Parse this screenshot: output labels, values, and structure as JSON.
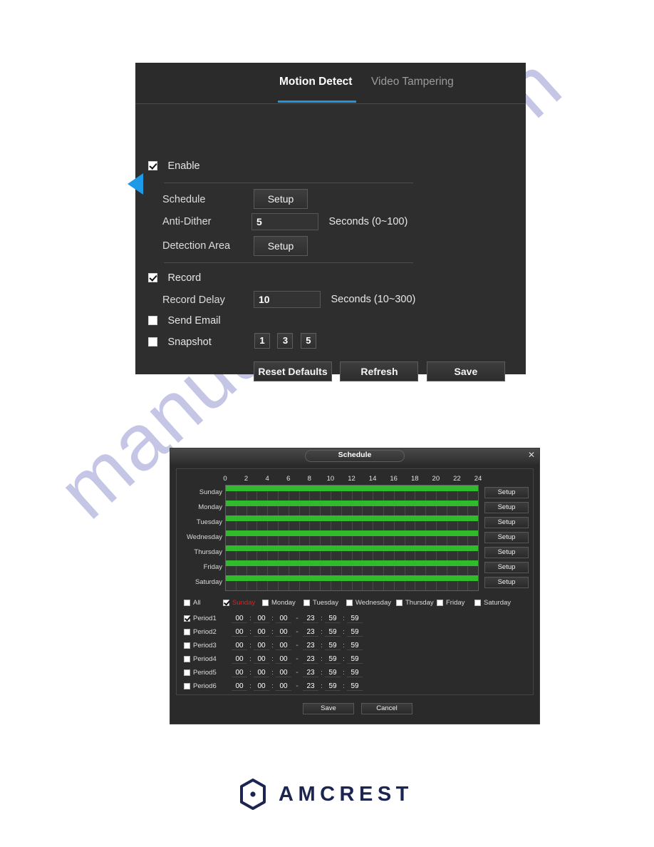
{
  "watermark": {
    "text": "manualshive.com"
  },
  "motion_detect_panel": {
    "tabs": [
      {
        "label": "Motion Detect",
        "active": true
      },
      {
        "label": "Video Tampering",
        "active": false
      }
    ],
    "enable": {
      "label": "Enable",
      "checked": true
    },
    "schedule": {
      "label": "Schedule",
      "button_label": "Setup"
    },
    "anti_dither": {
      "label": "Anti-Dither",
      "value": "5",
      "units": "Seconds (0~100)"
    },
    "detection_area": {
      "label": "Detection Area",
      "button_label": "Setup"
    },
    "record": {
      "label": "Record",
      "checked": true
    },
    "record_delay": {
      "label": "Record Delay",
      "value": "10",
      "units": "Seconds (10~300)"
    },
    "send_email": {
      "label": "Send Email",
      "checked": false
    },
    "snapshot": {
      "label": "Snapshot",
      "checked": false,
      "options": [
        "1",
        "3",
        "5"
      ]
    },
    "actions": {
      "reset_defaults": "Reset Defaults",
      "refresh": "Refresh",
      "save": "Save"
    },
    "accent_color": "#1e96e0"
  },
  "schedule_dialog": {
    "title": "Schedule",
    "close_label": "✕",
    "axis_ticks": [
      "0",
      "2",
      "4",
      "6",
      "8",
      "10",
      "12",
      "14",
      "16",
      "18",
      "20",
      "22",
      "24"
    ],
    "days": [
      {
        "name": "Sunday",
        "setup_label": "Setup"
      },
      {
        "name": "Monday",
        "setup_label": "Setup"
      },
      {
        "name": "Tuesday",
        "setup_label": "Setup"
      },
      {
        "name": "Wednesday",
        "setup_label": "Setup"
      },
      {
        "name": "Thursday",
        "setup_label": "Setup"
      },
      {
        "name": "Friday",
        "setup_label": "Setup"
      },
      {
        "name": "Saturday",
        "setup_label": "Setup"
      }
    ],
    "day_checkboxes": [
      {
        "label": "All",
        "checked": false,
        "selected": false
      },
      {
        "label": "Sunday",
        "checked": true,
        "selected": true
      },
      {
        "label": "Monday",
        "checked": false,
        "selected": false
      },
      {
        "label": "Tuesday",
        "checked": false,
        "selected": false
      },
      {
        "label": "Wednesday",
        "checked": false,
        "selected": false
      },
      {
        "label": "Thursday",
        "checked": false,
        "selected": false
      },
      {
        "label": "Friday",
        "checked": false,
        "selected": false
      },
      {
        "label": "Saturday",
        "checked": false,
        "selected": false
      }
    ],
    "periods": [
      {
        "label": "Period1",
        "checked": true,
        "start_h": "00",
        "start_m": "00",
        "start_s": "00",
        "end_h": "23",
        "end_m": "59",
        "end_s": "59"
      },
      {
        "label": "Period2",
        "checked": false,
        "start_h": "00",
        "start_m": "00",
        "start_s": "00",
        "end_h": "23",
        "end_m": "59",
        "end_s": "59"
      },
      {
        "label": "Period3",
        "checked": false,
        "start_h": "00",
        "start_m": "00",
        "start_s": "00",
        "end_h": "23",
        "end_m": "59",
        "end_s": "59"
      },
      {
        "label": "Period4",
        "checked": false,
        "start_h": "00",
        "start_m": "00",
        "start_s": "00",
        "end_h": "23",
        "end_m": "59",
        "end_s": "59"
      },
      {
        "label": "Period5",
        "checked": false,
        "start_h": "00",
        "start_m": "00",
        "start_s": "00",
        "end_h": "23",
        "end_m": "59",
        "end_s": "59"
      },
      {
        "label": "Period6",
        "checked": false,
        "start_h": "00",
        "start_m": "00",
        "start_s": "00",
        "end_h": "23",
        "end_m": "59",
        "end_s": "59"
      }
    ],
    "time_separator": ":",
    "range_separator": "-",
    "footer": {
      "save": "Save",
      "cancel": "Cancel"
    },
    "bar_color": "#2fbb2b",
    "selected_day_color": "#e41f1f"
  },
  "brand": {
    "name": "AMCREST",
    "color": "#1c2450"
  }
}
